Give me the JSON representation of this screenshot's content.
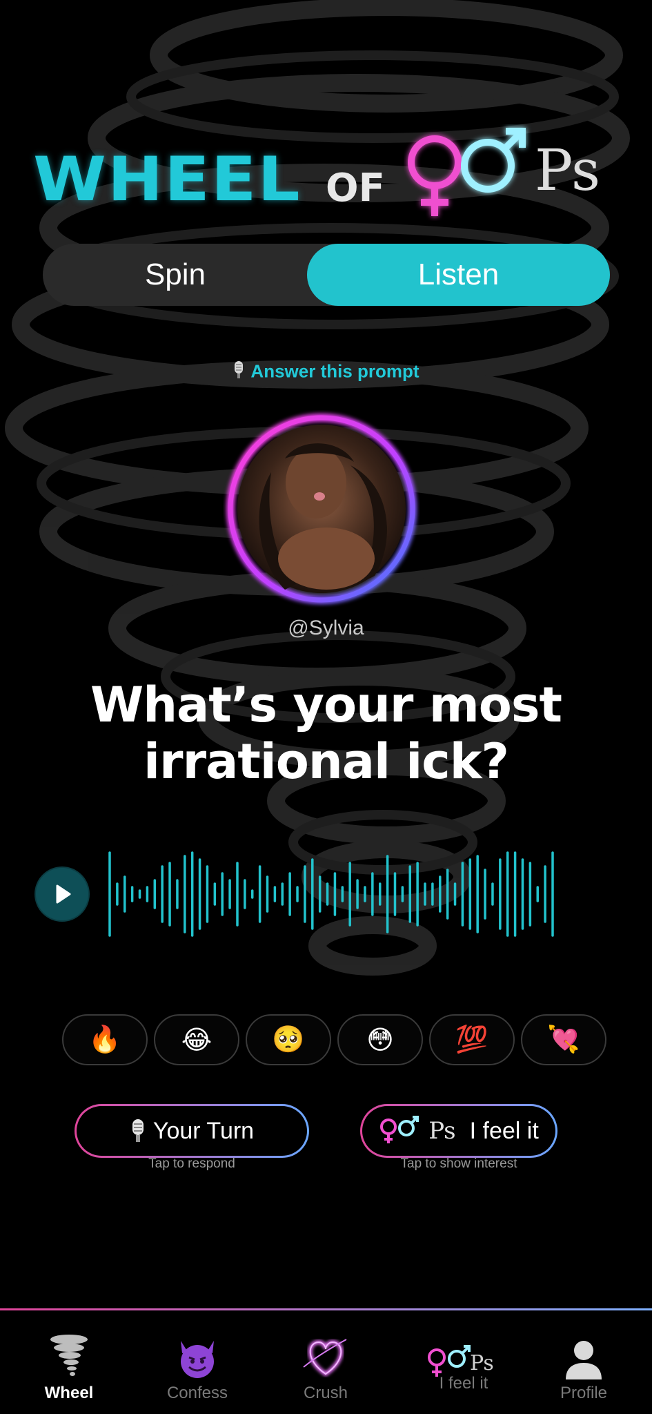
{
  "logo": {
    "word1": "WHEEL",
    "word2": "OF",
    "word3": "Ps"
  },
  "tabs": [
    {
      "label": "Spin",
      "active": false
    },
    {
      "label": "Listen",
      "active": true
    }
  ],
  "prompt": {
    "label": "Answer this prompt",
    "username": "@Sylvia",
    "question": "What’s your most irrational ick?"
  },
  "audio": {
    "icon": "play-icon"
  },
  "reactions": [
    {
      "emoji": "🔥",
      "name": "fire"
    },
    {
      "emoji": "😂",
      "name": "laughing"
    },
    {
      "emoji": "🥺",
      "name": "pleading"
    },
    {
      "emoji": "😳",
      "name": "flushed"
    },
    {
      "emoji": "💯",
      "name": "hundred"
    },
    {
      "emoji": "💘",
      "name": "heart-arrow"
    }
  ],
  "actions": {
    "your_turn": {
      "label": "Your Turn",
      "sub": "Tap to respond"
    },
    "feel_it": {
      "brand": "Ps",
      "label": "I feel it",
      "sub": "Tap to show interest"
    }
  },
  "nav": [
    {
      "label": "Wheel",
      "icon": "tornado-icon",
      "active": true
    },
    {
      "label": "Confess",
      "icon": "devil-icon",
      "active": false
    },
    {
      "label": "Crush",
      "icon": "heart-icon",
      "active": false
    },
    {
      "label": "I feel it",
      "icon": "oops-logo-icon",
      "active": false
    },
    {
      "label": "Profile",
      "icon": "profile-icon",
      "active": false
    }
  ],
  "colors": {
    "accent": "#22c3cd",
    "pink": "#e0449a",
    "blue": "#6aa7ff",
    "background": "#000000"
  }
}
